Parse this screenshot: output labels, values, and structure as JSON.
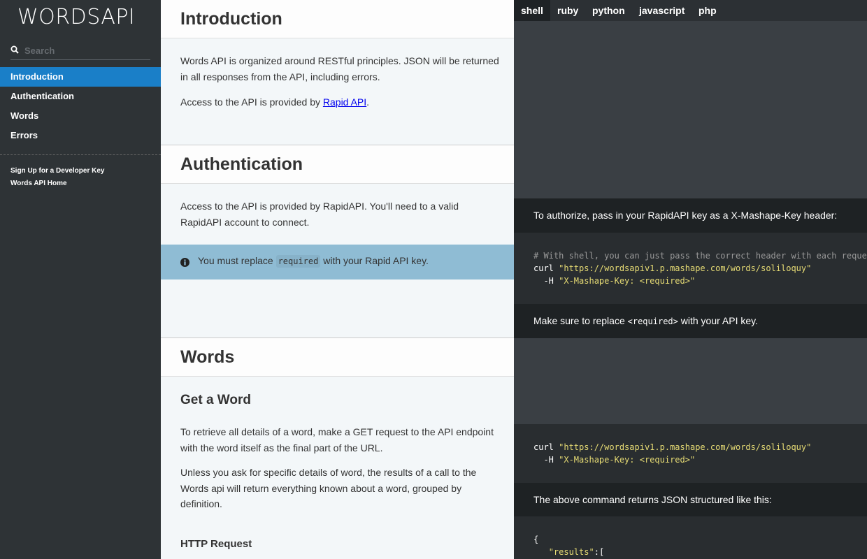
{
  "sidebar": {
    "logo": "WORDSAPI",
    "search_placeholder": "Search",
    "toc": [
      {
        "label": "Introduction",
        "active": true
      },
      {
        "label": "Authentication",
        "active": false
      },
      {
        "label": "Words",
        "active": false
      },
      {
        "label": "Errors",
        "active": false
      }
    ],
    "footer_links": [
      "Sign Up for a Developer Key",
      "Words API Home"
    ]
  },
  "content": {
    "introduction": {
      "title": "Introduction",
      "para1": "Words API is organized around RESTful principles. JSON will be returned in all responses from the API, including errors.",
      "para2_prefix": "Access to the API is provided by ",
      "para2_link": "Rapid API",
      "para2_suffix": "."
    },
    "authentication": {
      "title": "Authentication",
      "para1": "Access to the API is provided by RapidAPI. You'll need to a valid RapidAPI account to connect.",
      "notice_prefix": "You must replace ",
      "notice_code": "required",
      "notice_suffix": " with your Rapid API key."
    },
    "words": {
      "title": "Words",
      "subtitle": "Get a Word",
      "para1": "To retrieve all details of a word, make a GET request to the API endpoint with the word itself as the final part of the URL.",
      "para2": "Unless you ask for specific details of word, the results of a call to the Words api will return everything known about a word, grouped by definition.",
      "http_heading": "HTTP Request"
    }
  },
  "code_panel": {
    "tabs": [
      {
        "label": "shell",
        "active": true
      },
      {
        "label": "ruby",
        "active": false
      },
      {
        "label": "python",
        "active": false
      },
      {
        "label": "javascript",
        "active": false
      },
      {
        "label": "php",
        "active": false
      }
    ],
    "auth_note": "To authorize, pass in your RapidAPI key as a X-Mashape-Key header:",
    "auth_code": {
      "comment": "# With shell, you can just pass the correct header with each request",
      "cmd": "curl ",
      "url": "\"https://wordsapiv1.p.mashape.com/words/soliloquy\"",
      "flag": "  -H ",
      "header": "\"X-Mashape-Key: <required>\""
    },
    "replace_note_prefix": "Make sure to replace ",
    "replace_note_code": "<required>",
    "replace_note_suffix": " with your API key.",
    "word_code": {
      "cmd": "curl ",
      "url": "\"https://wordsapiv1.p.mashape.com/words/soliloquy\"",
      "flag": "  -H ",
      "header": "\"X-Mashape-Key: <required>\""
    },
    "returns_note": "The above command returns JSON structured like this:",
    "json_line1": "{",
    "json_line2_indent": "   ",
    "json_line2_key": "\"results\"",
    "json_line2_rest": ":["
  },
  "colors": {
    "sidebar_bg": "#2e3336",
    "active_toc": "#1a7fc8",
    "notice_bg": "#8fbcd4",
    "code_string": "#e6db74"
  }
}
